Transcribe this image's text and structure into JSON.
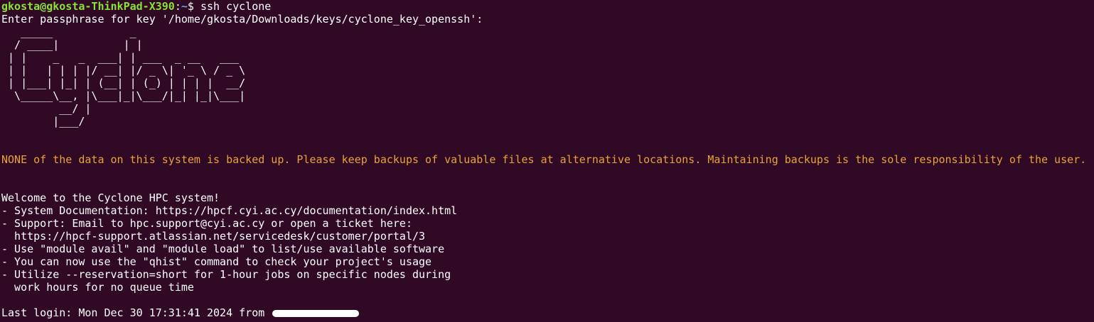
{
  "window": {
    "background": "#300a24",
    "text_color": "#ffffff"
  },
  "prompt": {
    "user_host": "gkosta@gkosta-ThinkPad-X390",
    "colon": ":",
    "path": "~",
    "symbol": "$ ",
    "command": "ssh cyclone",
    "user_color": "#8ae234",
    "path_color": "#729fcf"
  },
  "passphrase_prompt": "Enter passphrase for key '/home/gkosta/Downloads/keys/cyclone_key_openssh':",
  "banner_ascii": [
    "   _____            _",
    "  / ____|          | |",
    " | |    _   _  ___| | ___  _ __   ___",
    " | |   | | | |/ __| |/ _ \\| '_ \\ / _ \\",
    " | |___| |_| | (__| | (_) | | | |  __/",
    "  \\_____\\__, |\\___|_|\\___/|_| |_|\\___|",
    "         __/ |",
    "        |___/"
  ],
  "warning": {
    "text": "NONE of the data on this system is backed up. Please keep backups of valuable files at alternative locations. Maintaining backups is the sole responsibility of the user.",
    "color": "#e9a23b"
  },
  "welcome_lines": [
    "Welcome to the Cyclone HPC system!",
    "- System Documentation: https://hpcf.cyi.ac.cy/documentation/index.html",
    "- Support: Email to hpc.support@cyi.ac.cy or open a ticket here:",
    "  https://hpcf-support.atlassian.net/servicedesk/customer/portal/3",
    "- Use \"module avail\" and \"module load\" to list/use available software",
    "- You can now use the \"qhist\" command to check your project's usage",
    "- Utilize --reservation=short for 1-hour jobs on specific nodes during",
    "  work hours for no queue time"
  ],
  "last_login": {
    "text": "Last login: Mon Dec 30 17:31:41 2024 from "
  }
}
